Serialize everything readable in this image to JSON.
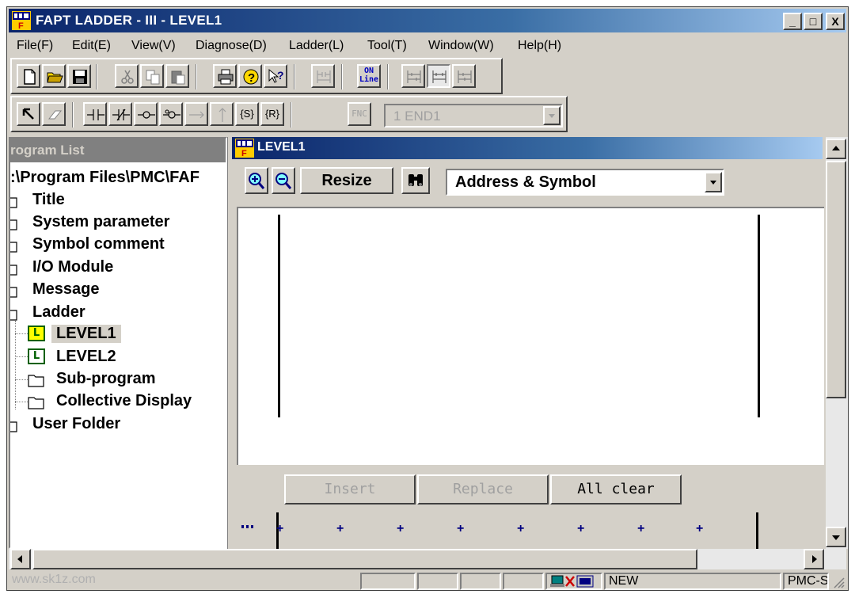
{
  "window": {
    "title": "FAPT LADDER - III - LEVEL1",
    "controls": {
      "minimize": "_",
      "maximize": "□",
      "close": "X"
    }
  },
  "menu": [
    "File(F)",
    "Edit(E)",
    "View(V)",
    "Diagnose(D)",
    "Ladder(L)",
    "Tool(T)",
    "Window(W)",
    "Help(H)"
  ],
  "toolbar1": {
    "online_label_line1": "ON",
    "online_label_line2": "Line"
  },
  "toolbar2": {
    "fnc_label": "FNC",
    "set_label": "{S}",
    "reset_label": "{R}",
    "end_combo_value": "1 END1"
  },
  "program_list": {
    "header": "rogram List",
    "root_path": ":\\Program Files\\PMC\\FAF",
    "items": {
      "title": "Title",
      "system_parameter": "System parameter",
      "symbol_comment": "Symbol comment",
      "io_module": "I/O Module",
      "message": "Message",
      "ladder": "Ladder",
      "level1": "LEVEL1",
      "level2": "LEVEL2",
      "sub_program": "Sub-program",
      "collective_display": "Collective Display",
      "user_folder": "User Folder"
    },
    "level_icon_letter": "L"
  },
  "child_window": {
    "title": "LEVEL1",
    "resize_label": "Resize",
    "display_mode": "Address & Symbol"
  },
  "edit_bar": {
    "insert": "Insert",
    "replace": "Replace",
    "all_clear": "All clear"
  },
  "status": {
    "watermark": "www.sk1z.com",
    "mode": "NEW",
    "model": "PMC-S"
  },
  "colors": {
    "title_active": "#0a246a",
    "face": "#d4d0c8",
    "selection_icon": "#ffff00"
  }
}
